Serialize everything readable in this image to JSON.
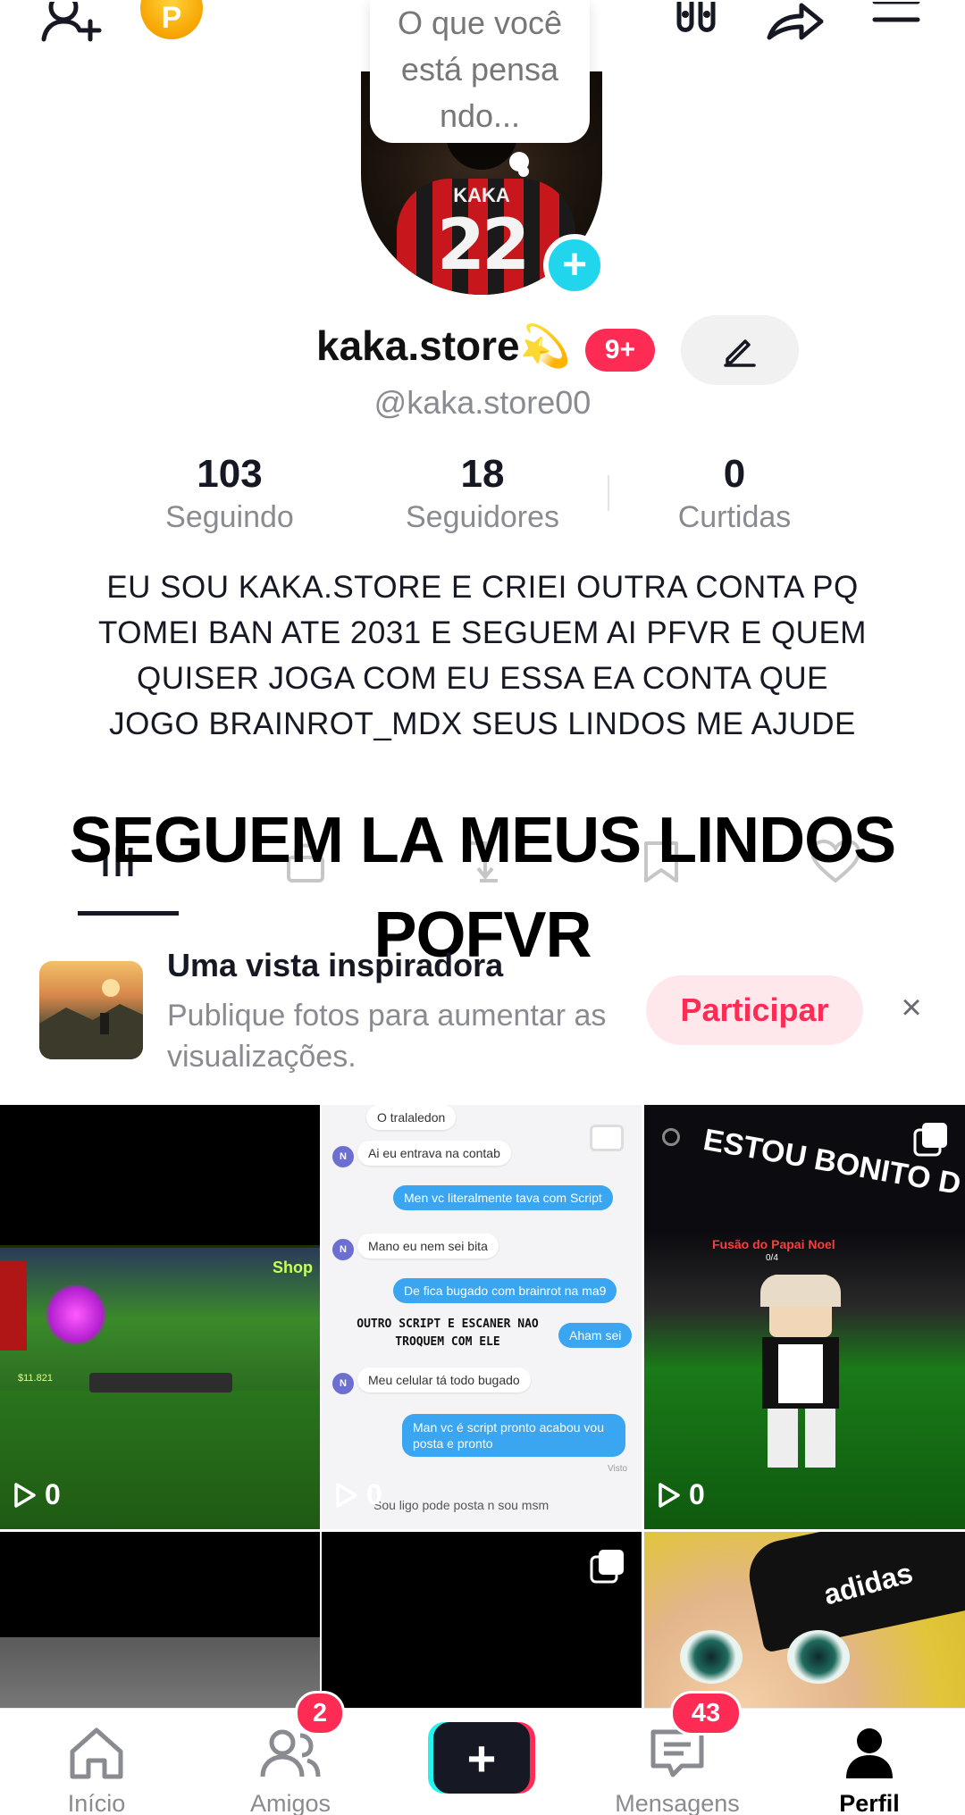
{
  "topbar": {
    "coin_label": "P"
  },
  "avatar": {
    "thought_bubble": "O que você está pensa ndo...",
    "jersey_name": "KAKA",
    "jersey_number": "22",
    "add_symbol": "+"
  },
  "profile": {
    "display_name": "kaka.store💫",
    "notification_badge": "9+",
    "handle": "@kaka.store00"
  },
  "stats": [
    {
      "value": "103",
      "label": "Seguindo"
    },
    {
      "value": "18",
      "label": "Seguidores"
    },
    {
      "value": "0",
      "label": "Curtidas"
    }
  ],
  "bio": "EU SOU KAKA.STORE E CRIEI OUTRA CONTA PQ TOMEI BAN ATE 2031 E SEGUEM AI PFVR E QUEM QUISER JOGA COM EU ESSA EA CONTA QUE JOGO BRAINROT_MDX SEUS LINDOS ME AJUDE",
  "overlay_text": "SEGUEM LA MEUS LINDOS POFVR",
  "promo": {
    "title": "Uma vista inspiradora",
    "subtitle": "Publique fotos para aumentar as visualizações.",
    "join_label": "Participar",
    "close_symbol": "×"
  },
  "videos": [
    {
      "views": "0",
      "shop_label": "Shop",
      "money": "$11.821"
    },
    {
      "views": "0",
      "messages": [
        "O tralaledon",
        "Ai eu entrava na contab",
        "Men vc literalmente tava com Script",
        "Mano eu nem sei bita",
        "De fica bugado com brainrot na ma9",
        "Aham sei",
        "Meu celular tá todo bugado",
        "Man vc é script pronto acabou vou posta e pronto",
        "Visto",
        "Sou ligo pode posta n sou msm"
      ],
      "overlay": "OUTRO SCRIPT E ESCANER NAO TROQUEM COM ELE"
    },
    {
      "views": "0",
      "caption": "ESTOU BONITO D KAKAKAAKA",
      "subcaption": "Fusão do Papai Noel",
      "counter": "0/4"
    },
    {},
    {},
    {
      "cap_brand": "adidas"
    }
  ],
  "bottom_nav": [
    {
      "label": "Início",
      "icon": "home-icon"
    },
    {
      "label": "Amigos",
      "icon": "friends-icon",
      "badge": "2"
    },
    {
      "label": "",
      "icon": "plus-icon"
    },
    {
      "label": "Mensagens",
      "icon": "inbox-icon",
      "badge": "43"
    },
    {
      "label": "Perfil",
      "icon": "profile-icon"
    }
  ],
  "colors": {
    "accent": "#fe2c55",
    "cyan": "#20d5ec",
    "text": "#161823",
    "muted": "#8a8b91"
  }
}
